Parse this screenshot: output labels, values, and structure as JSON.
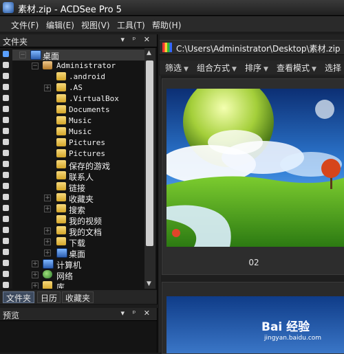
{
  "window": {
    "title": "素材.zip - ACDSee Pro 5"
  },
  "menu": {
    "items": [
      "文件(F)",
      "编辑(E)",
      "视图(V)",
      "工具(T)",
      "帮助(H)"
    ]
  },
  "folders_pane": {
    "title": "文件夹",
    "controls": "▾ ᵖ ✕",
    "tree": [
      {
        "label": "桌面",
        "selected": true
      },
      {
        "label": "Administrator"
      },
      {
        "label": ".android"
      },
      {
        "label": ".AS"
      },
      {
        "label": ".VirtualBox"
      },
      {
        "label": "Documents"
      },
      {
        "label": "Music"
      },
      {
        "label": "Music"
      },
      {
        "label": "Pictures"
      },
      {
        "label": "Pictures"
      },
      {
        "label": "保存的游戏"
      },
      {
        "label": "联系人"
      },
      {
        "label": "链接"
      },
      {
        "label": "收藏夹"
      },
      {
        "label": "搜索"
      },
      {
        "label": "我的视频"
      },
      {
        "label": "我的文档"
      },
      {
        "label": "下载"
      },
      {
        "label": "桌面"
      },
      {
        "label": "计算机"
      },
      {
        "label": "网络"
      },
      {
        "label": "库"
      }
    ],
    "tabs": [
      "文件夹",
      "日历",
      "收藏夹"
    ]
  },
  "preview_pane": {
    "title": "预览",
    "controls": "▾ ᵖ ✕"
  },
  "browser": {
    "path": "C:\\Users\\Administrator\\Desktop\\素材.zip",
    "toolbar": [
      "筛选",
      "组合方式",
      "排序",
      "查看模式",
      "选择"
    ],
    "thumbnail_label": "02"
  },
  "watermark": {
    "brand": "Bai 经验",
    "url": "jingyan.baidu.com"
  },
  "colors": {
    "selection": "#3d4a5e",
    "folder": "#e0b53c",
    "background": "#1c1c1c"
  }
}
